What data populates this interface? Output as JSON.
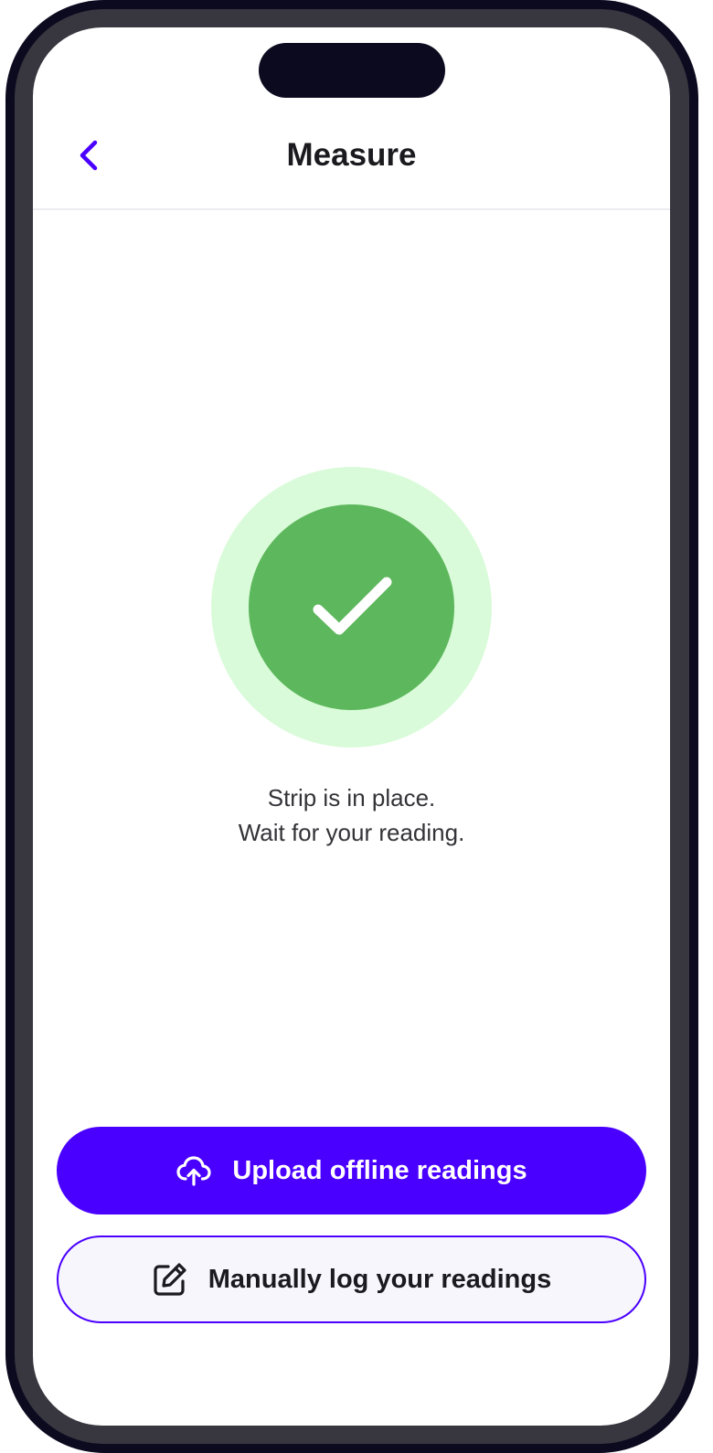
{
  "header": {
    "title": "Measure"
  },
  "status": {
    "line1": "Strip is in place.",
    "line2": "Wait for your reading."
  },
  "actions": {
    "upload_label": "Upload offline readings",
    "manual_label": "Manually log your readings"
  },
  "icons": {
    "back": "chevron-left-icon",
    "status": "checkmark-icon",
    "upload": "cloud-upload-icon",
    "manual": "edit-icon"
  },
  "colors": {
    "accent": "#4a00ff",
    "success": "#5db75c",
    "success_halo": "#d9fbd9",
    "secondary_bg": "#f7f6fd",
    "text": "#1b1b1f"
  }
}
